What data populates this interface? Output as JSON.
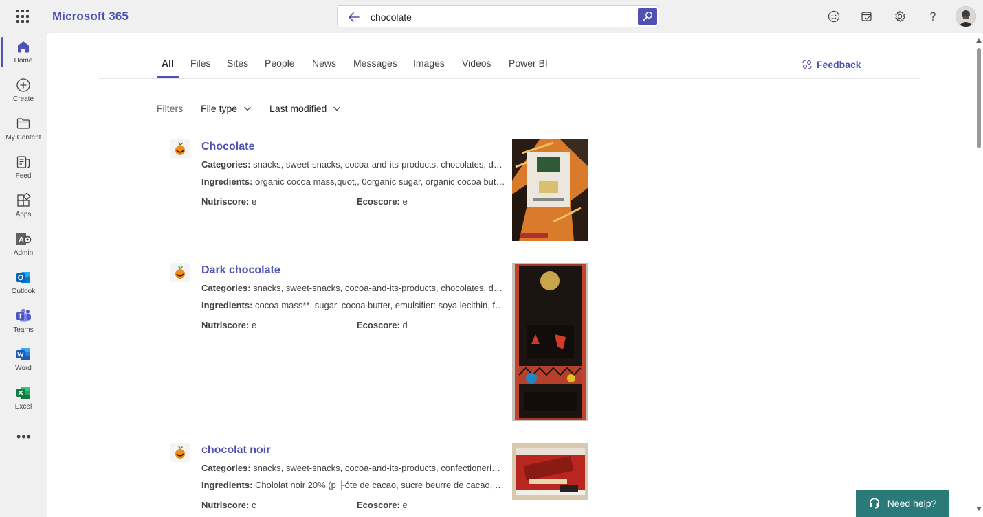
{
  "header": {
    "brand": "Microsoft 365",
    "search_value": "chocolate"
  },
  "rail": {
    "items": [
      {
        "label": "Home"
      },
      {
        "label": "Create"
      },
      {
        "label": "My Content"
      },
      {
        "label": "Feed"
      },
      {
        "label": "Apps"
      },
      {
        "label": "Admin"
      },
      {
        "label": "Outlook"
      },
      {
        "label": "Teams"
      },
      {
        "label": "Word"
      },
      {
        "label": "Excel"
      }
    ],
    "more": "•••"
  },
  "tabs": [
    "All",
    "Files",
    "Sites",
    "People",
    "News",
    "Messages",
    "Images",
    "Videos",
    "Power BI"
  ],
  "active_tab": "All",
  "feedback_label": "Feedback",
  "filters": {
    "label": "Filters",
    "file_type": "File type",
    "last_modified": "Last modified"
  },
  "labels": {
    "categories": "Categories:",
    "ingredients": "Ingredients:",
    "nutriscore": "Nutriscore:",
    "ecoscore": "Ecoscore:"
  },
  "results": [
    {
      "title": "Chocolate",
      "categories": "snacks, sweet-snacks, cocoa-and-its-products, chocolates, dark-chocolates",
      "ingredients": "organic cocoa mass,quot,, 0organic sugar, organic cocoa butter",
      "nutriscore": "e",
      "ecoscore": "e"
    },
    {
      "title": "Dark chocolate",
      "categories": "snacks, sweet-snacks, cocoa-and-its-products, chocolates, dark-chocolates",
      "ingredients": "cocoa mass**, sugar, cocoa butter, emulsifier: soya lecithin, flavouring",
      "nutriscore": "e",
      "ecoscore": "d"
    },
    {
      "title": "chocolat noir",
      "categories": "snacks, sweet-snacks, cocoa-and-its-products, confectioneries, chocolates",
      "ingredients": "Chololat noir 20% (p ├óte de cacao, sucre beurre de cacao, emulsifiant",
      "nutriscore": "c",
      "ecoscore": "e"
    }
  ],
  "need_help": "Need help?",
  "colors": {
    "brand": "#4f52b2",
    "help": "#2b7a7a"
  }
}
